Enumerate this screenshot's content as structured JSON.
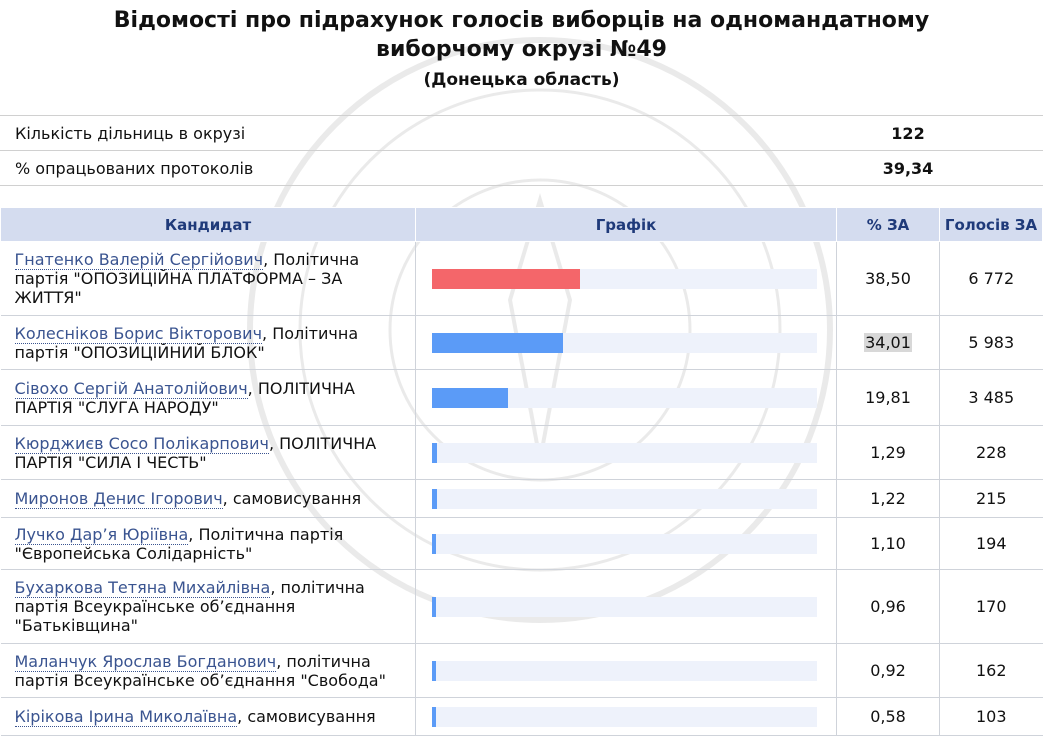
{
  "header": {
    "title_line1": "Відомості про підрахунок голосів виборців на одномандатному",
    "title_line2": "виборчому окрузі №49",
    "subtitle": "(Донецька область)"
  },
  "summary": [
    {
      "label": "Кількість дільниць в окрузі",
      "value": "122"
    },
    {
      "label": "% опрацьованих протоколів",
      "value": "39,34"
    }
  ],
  "columns": {
    "candidate": "Кандидат",
    "chart": "Графік",
    "percent": "% ЗА",
    "votes": "Голосів ЗА"
  },
  "colors": {
    "leader": "#f4666a",
    "other": "#5b9bf7",
    "track": "#eef2fb",
    "header_bg": "#d4dcef"
  },
  "chart_scale_max": 100,
  "rows": [
    {
      "name": "Гнатенко Валерій Сергійович",
      "party": ", Політична партія \"ОПОЗИЦІЙНА ПЛАТФОРМА – ЗА ЖИТТЯ\"",
      "percent": "38,50",
      "pct_value": 38.5,
      "votes": "6 772",
      "leader": true
    },
    {
      "name": "Колесніков Борис Вікторович",
      "party": ", Політична партія \"ОПОЗИЦІЙНИЙ БЛОК\"",
      "percent": "34,01",
      "pct_value": 34.01,
      "votes": "5 983",
      "leader": false,
      "highlight": true
    },
    {
      "name": "Сівохо Сергій Анатолійович",
      "party": ", ПОЛІТИЧНА ПАРТІЯ \"СЛУГА НАРОДУ\"",
      "percent": "19,81",
      "pct_value": 19.81,
      "votes": "3 485",
      "leader": false
    },
    {
      "name": "Кюрджиєв Сосо Полікарпович",
      "party": ", ПОЛІТИЧНА ПАРТІЯ \"СИЛА І ЧЕСТЬ\"",
      "percent": "1,29",
      "pct_value": 1.29,
      "votes": "228",
      "leader": false
    },
    {
      "name": "Миронов Денис Ігорович",
      "party": ", самовисування",
      "percent": "1,22",
      "pct_value": 1.22,
      "votes": "215",
      "leader": false
    },
    {
      "name": "Лучко Дар’я Юріївна",
      "party": ", Політична партія \"Європейська Солідарність\"",
      "percent": "1,10",
      "pct_value": 1.1,
      "votes": "194",
      "leader": false
    },
    {
      "name": "Бухаркова Тетяна Михайлівна",
      "party": ", політична партія Всеукраїнське об’єднання \"Батьківщина\"",
      "percent": "0,96",
      "pct_value": 0.96,
      "votes": "170",
      "leader": false
    },
    {
      "name": "Маланчук Ярослав Богданович",
      "party": ", політична партія Всеукраїнське об’єднання \"Свобода\"",
      "percent": "0,92",
      "pct_value": 0.92,
      "votes": "162",
      "leader": false
    },
    {
      "name": "Кірікова Ірина Миколаївна",
      "party": ", самовисування",
      "percent": "0,58",
      "pct_value": 0.58,
      "votes": "103",
      "leader": false
    }
  ]
}
